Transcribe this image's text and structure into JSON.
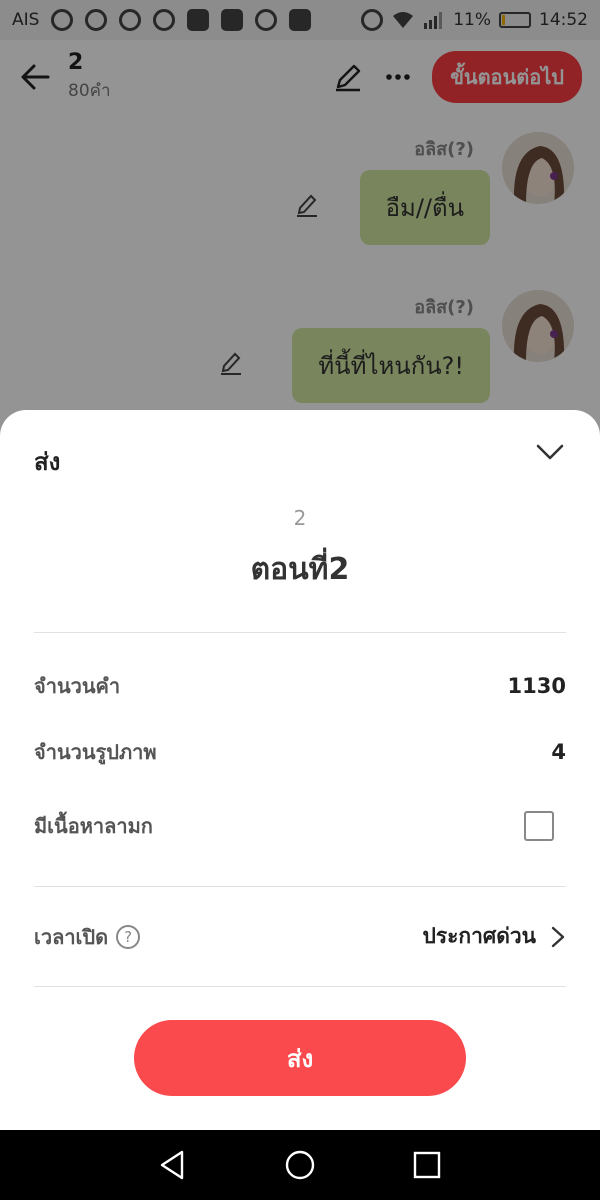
{
  "status_bar": {
    "carrier": "AIS",
    "battery": "11%",
    "battery_level": 0.11,
    "time": "14:52"
  },
  "header": {
    "title": "2",
    "word_count": "80คำ",
    "next_label": "ขั้นตอนต่อไป",
    "icons": [
      "back-arrow-icon",
      "edit-pen-icon",
      "more-dots-icon"
    ]
  },
  "chat": {
    "messages": [
      {
        "sender": "อลิส(?)",
        "text": "อืม//ตื่น"
      },
      {
        "sender": "อลิส(?)",
        "text": "ที่นี้ที่ไหนกัน?!"
      }
    ]
  },
  "sheet": {
    "title": "ส่ง",
    "episode_number": "2",
    "episode_title": "ตอนที่2",
    "rows": {
      "word_count_label": "จำนวนคำ",
      "word_count_value": "1130",
      "image_count_label": "จำนวนรูปภาพ",
      "image_count_value": "4",
      "adult_label": "มีเนื้อหาลามก",
      "adult_checked": false,
      "schedule_label": "เวลาเปิด",
      "schedule_value": "ประกาศด่วน"
    },
    "submit_label": "ส่ง"
  },
  "colors": {
    "accent": "#fa4a4d",
    "bubble": "#d1e5a0"
  }
}
